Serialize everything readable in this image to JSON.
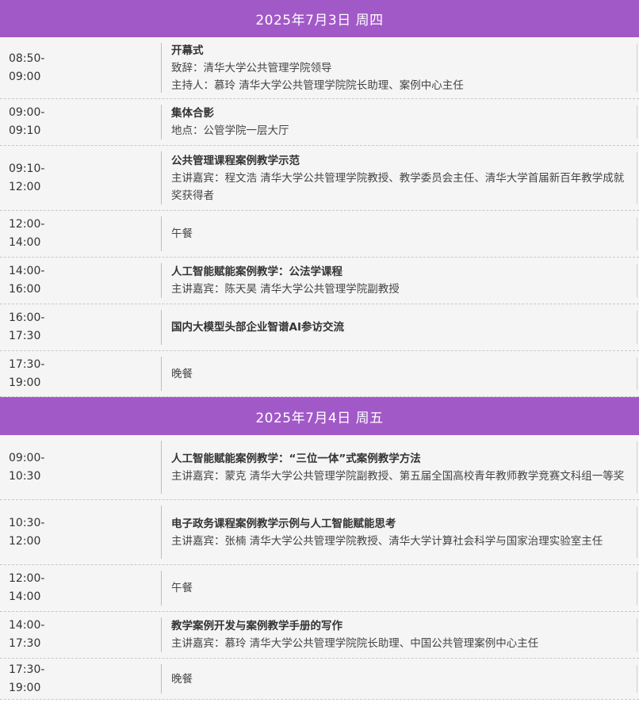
{
  "days": [
    {
      "header": "2025年7月3日  周四",
      "sessions": [
        {
          "start": "08:50-",
          "end": "09:00",
          "title": "开幕式",
          "details": [
            "致辞：清华大学公共管理学院领导",
            "主持人：慕玲     清华大学公共管理学院院长助理、案例中心主任"
          ]
        },
        {
          "start": "09:00-",
          "end": "09:10",
          "title": "集体合影",
          "details": [
            "地点：公管学院一层大厅"
          ]
        },
        {
          "start": "09:10-",
          "end": "12:00",
          "title": "公共管理课程案例教学示范",
          "details": [
            "主讲嘉宾：程文浩   清华大学公共管理学院教授、教学委员会主任、清华大学首届新百年教学成就奖获得者"
          ]
        },
        {
          "start": "12:00-",
          "end": "14:00",
          "title": "",
          "details": [
            "午餐"
          ]
        },
        {
          "start": "14:00-",
          "end": "16:00",
          "title": "人工智能赋能案例教学：公法学课程",
          "details": [
            "主讲嘉宾：陈天昊   清华大学公共管理学院副教授"
          ]
        },
        {
          "start": "16:00-",
          "end": "17:30",
          "title": "国内大模型头部企业智谱AI参访交流",
          "details": []
        },
        {
          "start": "17:30-",
          "end": "19:00",
          "title": "",
          "details": [
            "晚餐"
          ]
        }
      ]
    },
    {
      "header": "2025年7月4日  周五",
      "sessions": [
        {
          "start": "09:00-",
          "end": "10:30",
          "title": "人工智能赋能案例教学：“三位一体”式案例教学方法",
          "details": [
            "主讲嘉宾：蒙克   清华大学公共管理学院副教授、第五届全国高校青年教师教学竞赛文科组一等奖"
          ]
        },
        {
          "start": "10:30-",
          "end": "12:00",
          "title": "电子政务课程案例教学示例与人工智能赋能思考",
          "details": [
            "主讲嘉宾：张楠   清华大学公共管理学院教授、清华大学计算社会科学与国家治理实验室主任"
          ]
        },
        {
          "start": "12:00-",
          "end": "14:00",
          "title": "",
          "details": [
            "午餐"
          ]
        },
        {
          "start": "14:00-",
          "end": "17:30",
          "title": "教学案例开发与案例教学手册的写作",
          "details": [
            "主讲嘉宾：慕玲   清华大学公共管理学院院长助理、中国公共管理案例中心主任"
          ]
        },
        {
          "start": "17:30-",
          "end": "19:00",
          "title": "",
          "details": [
            "晚餐"
          ]
        }
      ]
    }
  ],
  "colors": {
    "header_bg": "#a259c8",
    "row_bg": "#f5f5f5"
  }
}
